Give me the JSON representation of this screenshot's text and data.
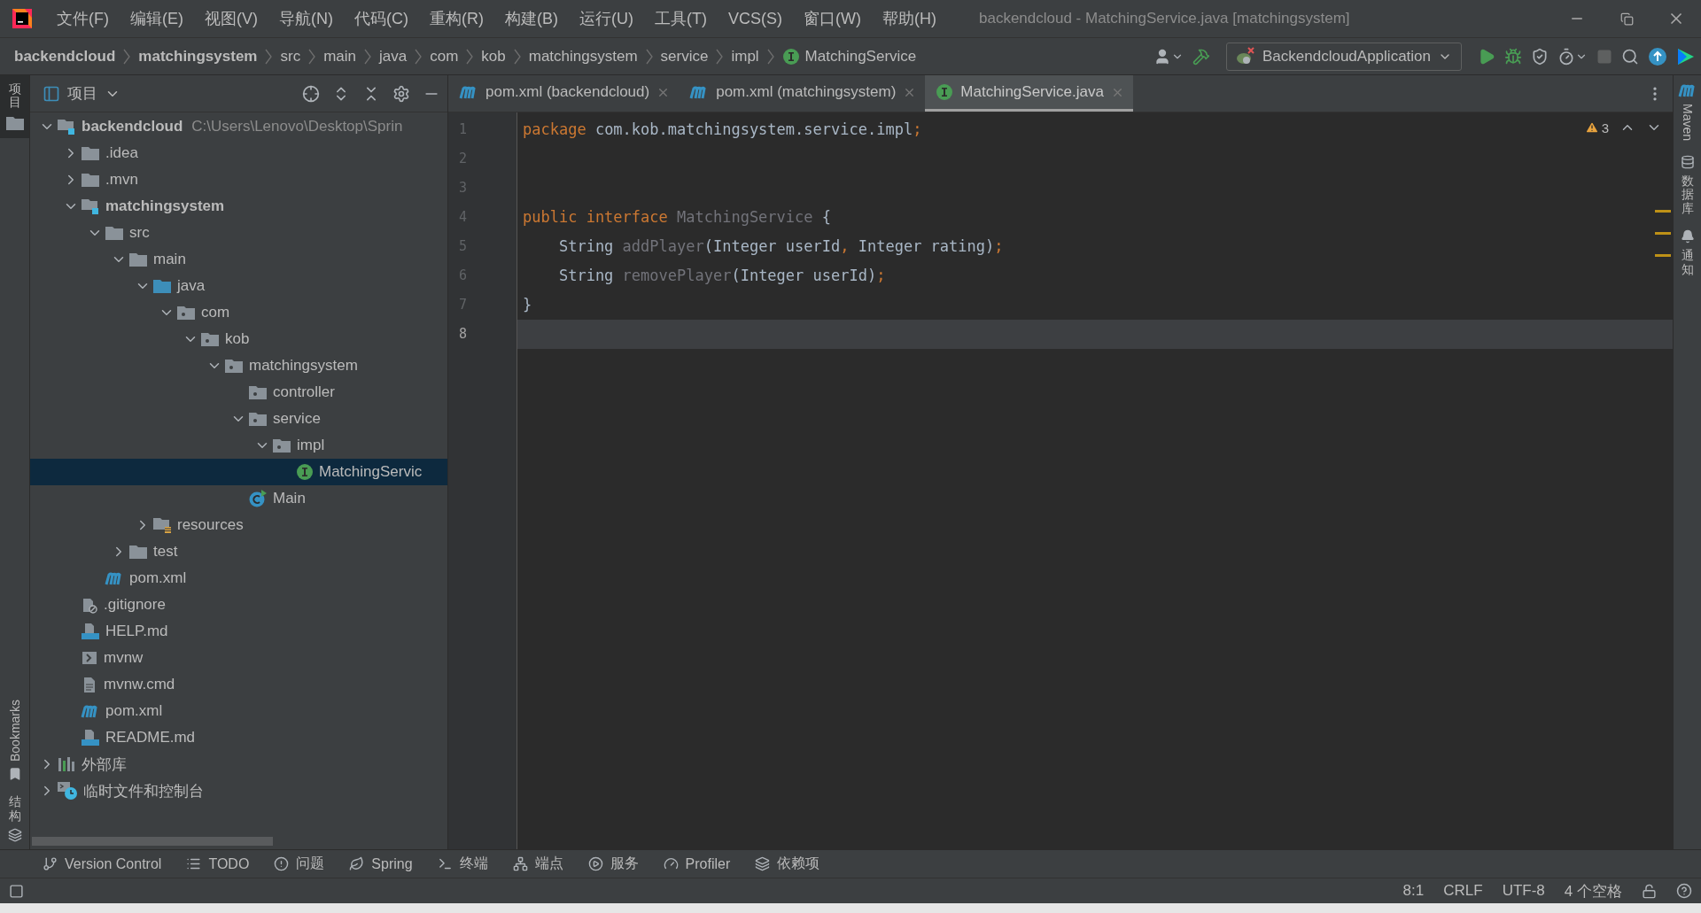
{
  "window": {
    "title": "backendcloud - MatchingService.java [matchingsystem]"
  },
  "menu": [
    "文件(F)",
    "编辑(E)",
    "视图(V)",
    "导航(N)",
    "代码(C)",
    "重构(R)",
    "构建(B)",
    "运行(U)",
    "工具(T)",
    "VCS(S)",
    "窗口(W)",
    "帮助(H)"
  ],
  "breadcrumbs": [
    {
      "label": "backendcloud",
      "bold": true
    },
    {
      "label": "matchingsystem",
      "bold": true
    },
    {
      "label": "src",
      "bold": false
    },
    {
      "label": "main",
      "bold": false
    },
    {
      "label": "java",
      "bold": false
    },
    {
      "label": "com",
      "bold": false
    },
    {
      "label": "kob",
      "bold": false
    },
    {
      "label": "matchingsystem",
      "bold": false
    },
    {
      "label": "service",
      "bold": false
    },
    {
      "label": "impl",
      "bold": false
    },
    {
      "label": "MatchingService",
      "bold": false,
      "kind": "interface"
    }
  ],
  "run_config": {
    "label": "BackendcloudApplication"
  },
  "left_stripe": [
    {
      "label": "项目",
      "kind": "cjk",
      "selected": true
    },
    {
      "label": "Bookmarks",
      "kind": "latin",
      "selected": false
    },
    {
      "label": "结构",
      "kind": "cjk",
      "selected": false
    }
  ],
  "right_stripe": [
    {
      "label": "Maven",
      "kind": "latin"
    },
    {
      "label": "数据库",
      "kind": "cjk"
    },
    {
      "label": "通知",
      "kind": "cjk"
    }
  ],
  "project_panel": {
    "title": "项目"
  },
  "tree": [
    {
      "label": "backendcloud",
      "kind": "module",
      "bold": true,
      "hint": "C:\\Users\\Lenovo\\Desktop\\Sprin",
      "expanded": true,
      "selected": false,
      "children": [
        {
          "label": ".idea",
          "kind": "folder",
          "bold": false,
          "expanded": false,
          "selected": false
        },
        {
          "label": ".mvn",
          "kind": "folder",
          "bold": false,
          "expanded": false,
          "selected": false
        },
        {
          "label": "matchingsystem",
          "kind": "module",
          "bold": true,
          "expanded": true,
          "selected": false,
          "children": [
            {
              "label": "src",
              "kind": "folder",
              "bold": false,
              "expanded": true,
              "selected": false,
              "children": [
                {
                  "label": "main",
                  "kind": "folder",
                  "bold": false,
                  "expanded": true,
                  "selected": false,
                  "children": [
                    {
                      "label": "java",
                      "kind": "source",
                      "bold": false,
                      "expanded": true,
                      "selected": false,
                      "children": [
                        {
                          "label": "com",
                          "kind": "package",
                          "bold": false,
                          "expanded": true,
                          "selected": false,
                          "children": [
                            {
                              "label": "kob",
                              "kind": "package",
                              "bold": false,
                              "expanded": true,
                              "selected": false,
                              "children": [
                                {
                                  "label": "matchingsystem",
                                  "kind": "package",
                                  "bold": false,
                                  "expanded": true,
                                  "selected": false,
                                  "children": [
                                    {
                                      "label": "controller",
                                      "kind": "package",
                                      "bold": false,
                                      "selected": false
                                    },
                                    {
                                      "label": "service",
                                      "kind": "package",
                                      "bold": false,
                                      "expanded": true,
                                      "selected": false,
                                      "children": [
                                        {
                                          "label": "impl",
                                          "kind": "package",
                                          "bold": false,
                                          "expanded": true,
                                          "selected": false,
                                          "children": [
                                            {
                                              "label": "MatchingServic",
                                              "kind": "interface",
                                              "bold": false,
                                              "selected": true
                                            }
                                          ]
                                        }
                                      ]
                                    },
                                    {
                                      "label": "Main",
                                      "kind": "class",
                                      "bold": false,
                                      "selected": false
                                    }
                                  ]
                                }
                              ]
                            }
                          ]
                        }
                      ]
                    },
                    {
                      "label": "resources",
                      "kind": "resources",
                      "bold": false,
                      "expanded": false,
                      "selected": false
                    }
                  ]
                },
                {
                  "label": "test",
                  "kind": "folder",
                  "bold": false,
                  "expanded": false,
                  "selected": false
                }
              ]
            },
            {
              "label": "pom.xml",
              "kind": "maven",
              "bold": false,
              "selected": false
            }
          ]
        },
        {
          "label": ".gitignore",
          "kind": "ignore",
          "bold": false,
          "selected": false
        },
        {
          "label": "HELP.md",
          "kind": "markdown",
          "bold": false,
          "selected": false
        },
        {
          "label": "mvnw",
          "kind": "script",
          "bold": false,
          "selected": false
        },
        {
          "label": "mvnw.cmd",
          "kind": "text",
          "bold": false,
          "selected": false
        },
        {
          "label": "pom.xml",
          "kind": "maven",
          "bold": false,
          "selected": false
        },
        {
          "label": "README.md",
          "kind": "markdown",
          "bold": false,
          "selected": false
        }
      ]
    },
    {
      "label": "外部库",
      "kind": "library",
      "bold": false,
      "expanded": false,
      "selected": false
    },
    {
      "label": "临时文件和控制台",
      "kind": "scratches",
      "bold": false,
      "expanded": false,
      "selected": false
    }
  ],
  "editor_tabs": [
    {
      "label": "pom.xml (backendcloud)",
      "kind": "maven",
      "selected": false
    },
    {
      "label": "pom.xml (matchingsystem)",
      "kind": "maven",
      "selected": false
    },
    {
      "label": "MatchingService.java",
      "kind": "interface",
      "selected": true
    }
  ],
  "inspection": {
    "warnings": "3"
  },
  "code_lines": [
    {
      "number": "1",
      "current": false,
      "tokens": [
        {
          "text": "package",
          "kind": "keyword"
        },
        {
          "text": " com.kob.matchingsystem.service.impl",
          "kind": "plain"
        },
        {
          "text": ";",
          "kind": "keyword"
        }
      ]
    },
    {
      "number": "2",
      "current": false
    },
    {
      "number": "3",
      "current": false
    },
    {
      "number": "4",
      "current": false,
      "tokens": [
        {
          "text": "public interface ",
          "kind": "keyword"
        },
        {
          "text": "MatchingService",
          "kind": "unused"
        },
        {
          "text": " {",
          "kind": "plain"
        }
      ]
    },
    {
      "number": "5",
      "current": false,
      "tokens": [
        {
          "text": "    String ",
          "kind": "plain"
        },
        {
          "text": "addPlayer",
          "kind": "unused"
        },
        {
          "text": "(Integer userId",
          "kind": "plain"
        },
        {
          "text": ",",
          "kind": "keyword"
        },
        {
          "text": " Integer rating)",
          "kind": "plain"
        },
        {
          "text": ";",
          "kind": "keyword"
        }
      ]
    },
    {
      "number": "6",
      "current": false,
      "tokens": [
        {
          "text": "    String ",
          "kind": "plain"
        },
        {
          "text": "removePlayer",
          "kind": "unused"
        },
        {
          "text": "(Integer userId)",
          "kind": "plain"
        },
        {
          "text": ";",
          "kind": "keyword"
        }
      ]
    },
    {
      "number": "7",
      "current": false,
      "tokens": [
        {
          "text": "}",
          "kind": "plain"
        }
      ]
    },
    {
      "number": "8",
      "current": true
    }
  ],
  "tool_windows": [
    {
      "label": "Version Control",
      "kind": "branch"
    },
    {
      "label": "TODO",
      "kind": "list"
    },
    {
      "label": "问题",
      "kind": "problem"
    },
    {
      "label": "Spring",
      "kind": "leaf"
    },
    {
      "label": "终端",
      "kind": "terminal"
    },
    {
      "label": "端点",
      "kind": "endpoints"
    },
    {
      "label": "服务",
      "kind": "services"
    },
    {
      "label": "Profiler",
      "kind": "profiler"
    },
    {
      "label": "依赖项",
      "kind": "layers"
    }
  ],
  "status_bar": [
    "8:1",
    "CRLF",
    "UTF-8",
    "4 个空格"
  ]
}
